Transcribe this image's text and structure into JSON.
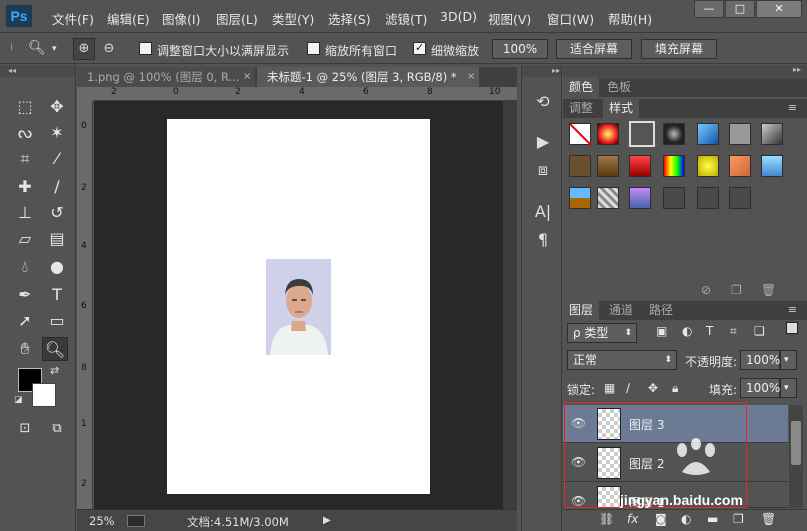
{
  "app": {
    "logo": "Ps"
  },
  "menu": [
    "文件(F)",
    "编辑(E)",
    "图像(I)",
    "图层(L)",
    "类型(Y)",
    "选择(S)",
    "滤镜(T)",
    "3D(D)",
    "视图(V)",
    "窗口(W)",
    "帮助(H)"
  ],
  "window_controls": {
    "minimize": "—",
    "maximize": "□",
    "close": "✕"
  },
  "options": {
    "zoom_in": "⊕",
    "zoom_out": "⊖",
    "resize_windows_label": "调整窗口大小以满屏显示",
    "zoom_all_label": "缩放所有窗口",
    "scrubby_label": "细微缩放",
    "scrubby_checked": true,
    "btn_100": "100%",
    "btn_fit": "适合屏幕",
    "btn_fill": "填充屏幕"
  },
  "doc_tabs": [
    {
      "label": "1.png @ 100% (图层 0, R...",
      "close": "×"
    },
    {
      "label": "未标题-1 @ 25% (图层 3, RGB/8) *",
      "close": "×"
    }
  ],
  "ruler": {
    "h_marks": [
      "2",
      "0",
      "2",
      "4",
      "6",
      "8",
      "10",
      "12",
      "14",
      "16",
      "18",
      "20",
      "22",
      "24"
    ],
    "v_marks": [
      "0",
      "2",
      "4",
      "6",
      "8",
      "1",
      "2",
      "1",
      "4",
      "1",
      "6",
      "1",
      "8",
      "2",
      "0"
    ]
  },
  "status": {
    "zoom": "25%",
    "doc_info": "文档:4.51M/3.00M"
  },
  "panels": {
    "color_tabs": [
      "颜色",
      "色板"
    ],
    "adjust_tabs": [
      "调整",
      "样式"
    ],
    "layer_tabs": [
      "图层",
      "通道",
      "路径"
    ],
    "kind_filter": "ρ 类型",
    "blend_mode": "正常",
    "opacity_label": "不透明度:",
    "opacity_value": "100%",
    "lock_label": "锁定:",
    "fill_label": "填充:",
    "fill_value": "100%"
  },
  "layers": [
    {
      "name": "图层 3",
      "selected": true
    },
    {
      "name": "图层 2",
      "selected": false
    },
    {
      "name": "图层 1",
      "selected": false
    }
  ],
  "watermark": "jingyan.baidu.com"
}
